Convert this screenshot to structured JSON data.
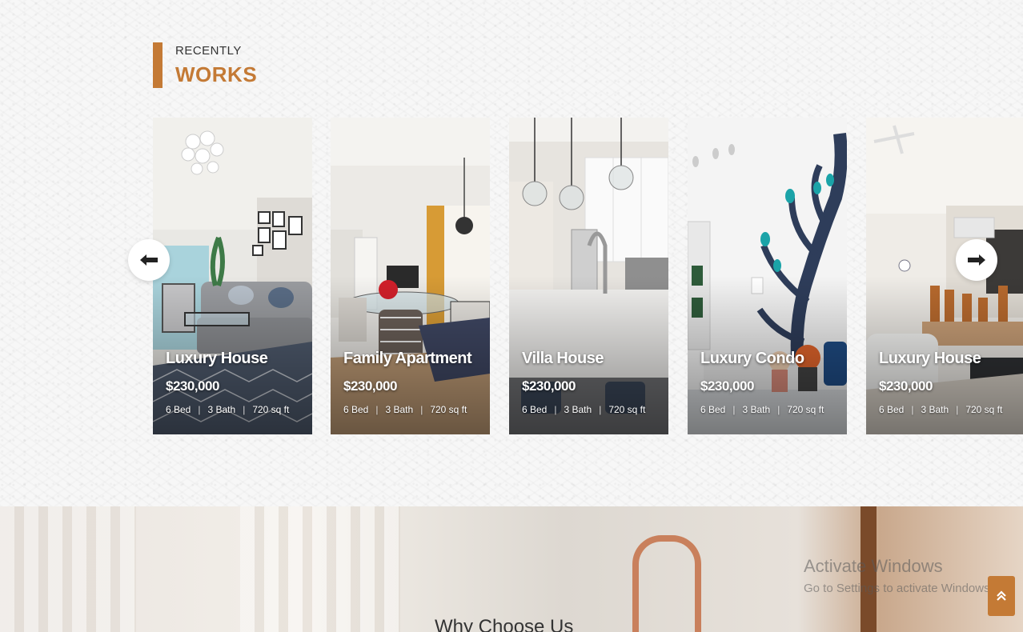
{
  "section": {
    "subtitle": "RECENTLY",
    "title": "WORKS"
  },
  "listings": [
    {
      "title": "Luxury House",
      "price": "$230,000",
      "beds": "6 Bed",
      "baths": "3 Bath",
      "area": "720 sq ft",
      "photo": "living-room"
    },
    {
      "title": "Family Apartment",
      "price": "$230,000",
      "beds": "6 Bed",
      "baths": "3 Bath",
      "area": "720 sq ft",
      "photo": "dining-room"
    },
    {
      "title": "Villa House",
      "price": "$230,000",
      "beds": "6 Bed",
      "baths": "3 Bath",
      "area": "720 sq ft",
      "photo": "kitchen"
    },
    {
      "title": "Luxury Condo",
      "price": "$230,000",
      "beds": "6 Bed",
      "baths": "3 Bath",
      "area": "720 sq ft",
      "photo": "kids-room"
    },
    {
      "title": "Luxury House",
      "price": "$230,000",
      "beds": "6 Bed",
      "baths": "3 Bath",
      "area": "720 sq ft",
      "photo": "dining-hall"
    }
  ],
  "carousel": {
    "prev_icon": "arrow-left-icon",
    "next_icon": "arrow-right-icon"
  },
  "why": {
    "title": "Why Choose Us"
  },
  "watermark": {
    "line1": "Activate Windows",
    "line2": "Go to Settings to activate Windows."
  },
  "scroll_top": {
    "icon": "double-chevron-up-icon"
  },
  "colors": {
    "accent": "#c47a35"
  }
}
